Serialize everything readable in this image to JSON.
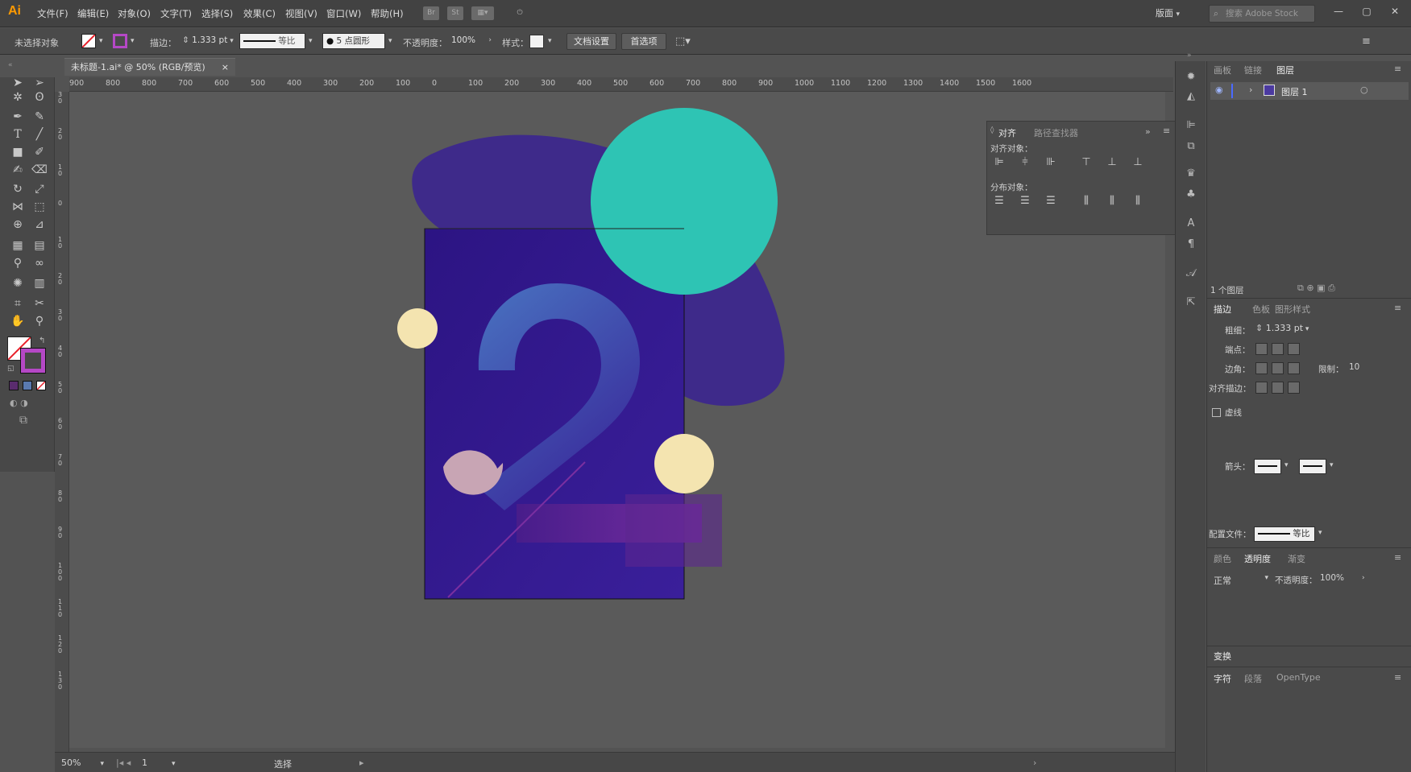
{
  "app": {
    "logo": "Ai"
  },
  "menu": [
    "文件(F)",
    "编辑(E)",
    "对象(O)",
    "文字(T)",
    "选择(S)",
    "效果(C)",
    "视图(V)",
    "窗口(W)",
    "帮助(H)"
  ],
  "topbar": {
    "bridge": "Br",
    "stock": "St",
    "workspace": "版面",
    "search_placeholder": "搜索 Adobe Stock"
  },
  "controlbar": {
    "selection_status": "未选择对象",
    "stroke_label": "描边：",
    "stroke_weight": "1.333",
    "stroke_unit": "pt",
    "profile": "等比",
    "brush": "5 点圆形",
    "opacity_label": "不透明度：",
    "opacity": "100%",
    "style_label": "样式：",
    "doc_setup": "文档设置",
    "preferences": "首选项"
  },
  "document": {
    "tab_title": "未标题-1.ai* @ 50% (RGB/预览)",
    "close": "×"
  },
  "rulers": {
    "top": [
      "900",
      "800",
      "800",
      "700",
      "600",
      "500",
      "400",
      "300",
      "200",
      "100",
      "0",
      "100",
      "200",
      "300",
      "400",
      "500",
      "600",
      "700",
      "800",
      "900",
      "1000",
      "1100",
      "1200",
      "1300",
      "1400",
      "1500",
      "1600"
    ],
    "left": [
      "3 0",
      "2 0",
      "1 0",
      "0",
      "1 0",
      "2 0",
      "3 0",
      "4 0",
      "5 0",
      "6 0",
      "7 0",
      "8 0",
      "9 0",
      "1 0 0",
      "1 1 0",
      "1 2 0",
      "1 3 0"
    ]
  },
  "artwork": {
    "numeral": "2",
    "colors": {
      "blob": "#3e2a8a",
      "teal": "#2ec4b4",
      "cream": "#f4e4b0",
      "artboard": "#2d1481",
      "numeral": "#3f66b8",
      "pink_circle": "#c8a5b4",
      "magenta": "#6e2a9a"
    }
  },
  "status": {
    "zoom": "50%",
    "page": "1",
    "tool": "选择"
  },
  "align_panel": {
    "tabs": [
      "对齐",
      "路径查找器"
    ],
    "align_objects": "对齐对象：",
    "distribute_objects": "分布对象："
  },
  "layers_panel": {
    "tabs": [
      "画板",
      "链接",
      "图层"
    ],
    "layer_name": "图层 1",
    "layer_count": "1 个图层"
  },
  "stroke_panel": {
    "tabs": [
      "描边",
      "色板",
      "图形样式"
    ],
    "weight_label": "粗细：",
    "weight": "1.333 pt",
    "cap_label": "端点：",
    "corner_label": "边角：",
    "limit_label": "限制：",
    "limit": "10",
    "align_label": "对齐描边：",
    "dashed_label": "虚线",
    "arrow_label": "箭头：",
    "profile_label": "配置文件：",
    "profile": "等比"
  },
  "transparency_panel": {
    "tabs": [
      "颜色",
      "透明度",
      "渐变"
    ],
    "mode": "正常",
    "opacity_label": "不透明度：",
    "opacity": "100%"
  },
  "bottom_panels": {
    "transform": "变换",
    "char_tabs": [
      "字符",
      "段落",
      "OpenType"
    ]
  }
}
